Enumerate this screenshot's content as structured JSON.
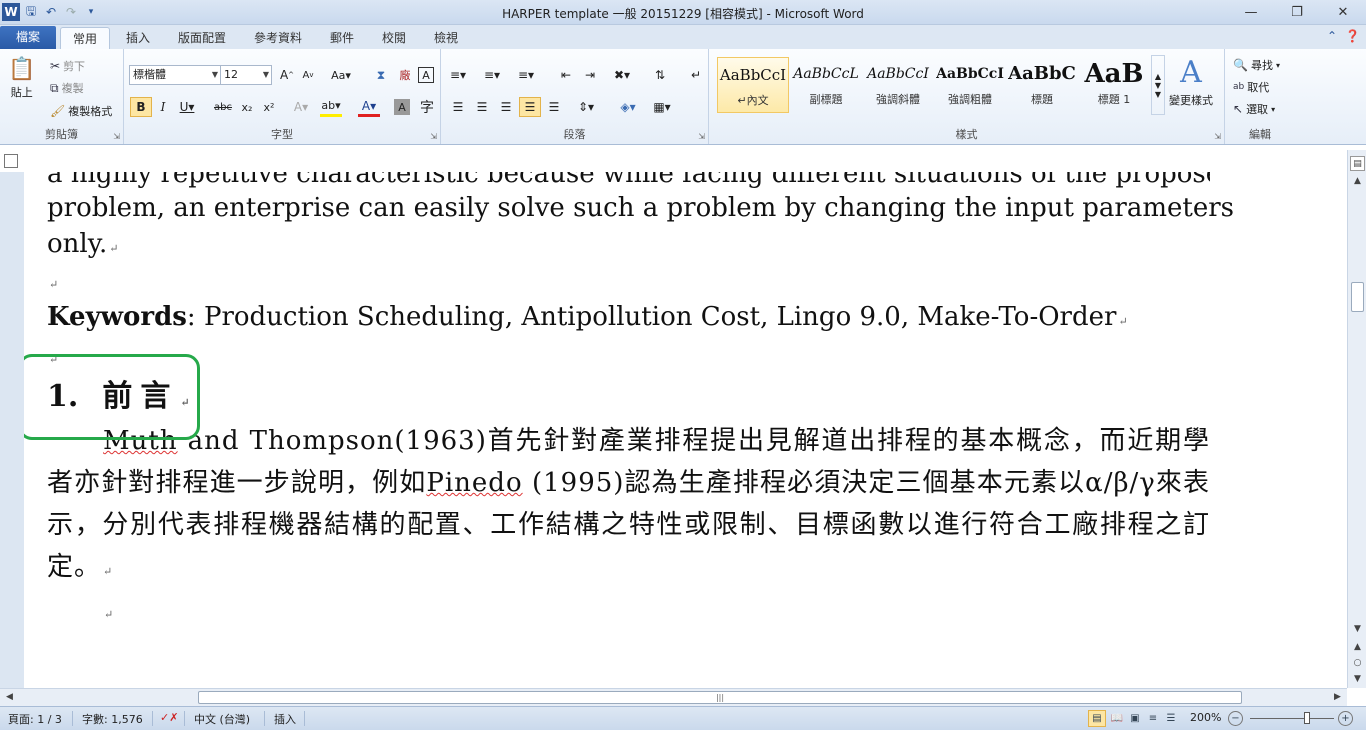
{
  "window": {
    "title": "HARPER template 一般 20151229 [相容模式] - Microsoft Word"
  },
  "tabs": {
    "file": "檔案",
    "items": [
      "常用",
      "插入",
      "版面配置",
      "參考資料",
      "郵件",
      "校閱",
      "檢視"
    ]
  },
  "ribbon": {
    "clipboard": {
      "paste": "貼上",
      "cut": "剪下",
      "copy": "複製",
      "format_painter": "複製格式",
      "label": "剪貼簿"
    },
    "font": {
      "name": "標楷體",
      "size": "12",
      "label": "字型"
    },
    "paragraph": {
      "label": "段落"
    },
    "styles": {
      "label": "樣式",
      "items": [
        {
          "preview": "AaBbCcI",
          "name": "↵內文"
        },
        {
          "preview": "AaBbCcL",
          "name": "副標題"
        },
        {
          "preview": "AaBbCcI",
          "name": "強調斜體"
        },
        {
          "preview": "AaBbCcI",
          "name": "強調粗體"
        },
        {
          "preview": "AaBbC",
          "name": "標題"
        },
        {
          "preview": "AaB",
          "name": "標題 1"
        }
      ],
      "change": "變更樣式"
    },
    "editing": {
      "find": "尋找",
      "replace": "取代",
      "select": "選取",
      "label": "編輯"
    }
  },
  "document": {
    "para1_line1": "a highly repetitive characteristic because while facing different situations of the proposed",
    "para1_line2": "problem, an enterprise can easily solve such a problem by changing the input parameters",
    "para1_line3": "only.",
    "keywords_label": "Keywords",
    "keywords_text": ": Production Scheduling, Antipollution Cost, Lingo 9.0, Make-To-Order",
    "heading_num": "1.",
    "heading_text": "前言",
    "body_part1": "Muth",
    "body_part2": " and Thompson(1963)首先針對產業排程提出見解道出排程的基本概念，而近期學者亦針對排程進一步說明，例如",
    "body_part3": "Pinedo",
    "body_part4": " (1995)認為生產排程必須決定三個基本元素以α/β/γ來表示，分別代表排程機器結構的配置、工作結構之特性或限制、目標函數以進行符合工廠排程之訂定。",
    "para_mark": "↵"
  },
  "status": {
    "page": "頁面: 1 / 3",
    "words": "字數: 1,576",
    "language": "中文 (台灣)",
    "mode": "插入",
    "zoom": "200%"
  },
  "colors": {
    "annotation": "#26a94a",
    "accent": "#2b579a"
  }
}
